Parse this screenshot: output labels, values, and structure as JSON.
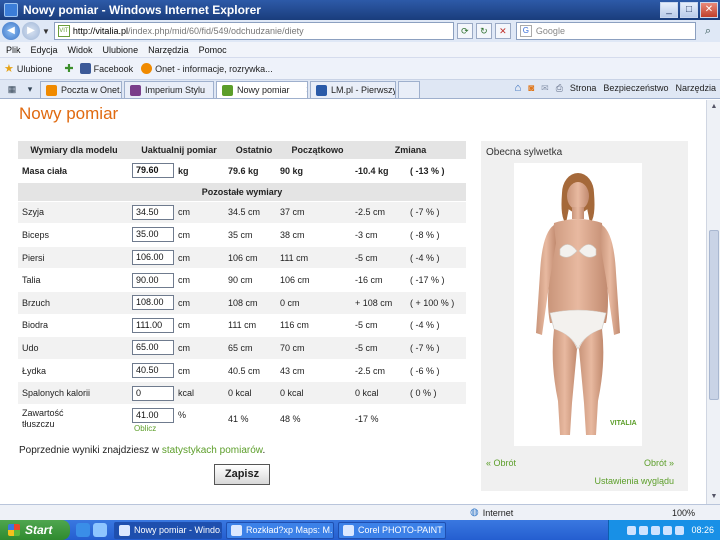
{
  "window": {
    "title": "Nowy pomiar - Windows Internet Explorer"
  },
  "address": {
    "url_host": "http://vitalia.pl",
    "url_path": "/index.php/mid/60/fid/549/odchudzanie/diety",
    "search_placeholder": "Google"
  },
  "menu": [
    "Plik",
    "Edycja",
    "Widok",
    "Ulubione",
    "Narzędzia",
    "Pomoc"
  ],
  "favorites": {
    "label": "Ulubione",
    "items": [
      {
        "label": "Facebook",
        "color": "#3b5998"
      },
      {
        "label": "Onet - informacje, rozrywka...",
        "color": "#f08a00"
      }
    ]
  },
  "tabs": [
    {
      "label": "Poczta w Onet.pl",
      "active": false,
      "color": "#f08a00"
    },
    {
      "label": "Imperium Stylu",
      "active": false,
      "color": "#7a3d8a"
    },
    {
      "label": "Nowy pomiar",
      "active": true,
      "color": "#5c9e2a"
    },
    {
      "label": "LM.pl - Pierwszy p...",
      "active": false,
      "color": "#2a5aa8"
    }
  ],
  "tab_tools": {
    "page": "Strona",
    "security": "Bezpieczeństwo",
    "tools": "Narzędzia"
  },
  "page": {
    "title": "Nowy pomiar",
    "headers": {
      "model": "Wymiary dla modelu",
      "update": "Uaktualnij pomiar",
      "last": "Ostatnio",
      "initial": "Początkowo",
      "change": "Zmiana"
    },
    "main_row": {
      "name": "Masa ciała",
      "value": "79.60",
      "unit": "kg",
      "last": "79.6 kg",
      "initial": "90 kg",
      "change": "-10.4 kg",
      "pct": "( -13 % )"
    },
    "other_header": "Pozostałe wymiary",
    "rows": [
      {
        "name": "Szyja",
        "value": "34.50",
        "unit": "cm",
        "last": "34.5 cm",
        "initial": "37 cm",
        "change": "-2.5 cm",
        "pct": "( -7 % )"
      },
      {
        "name": "Biceps",
        "value": "35.00",
        "unit": "cm",
        "last": "35 cm",
        "initial": "38 cm",
        "change": "-3 cm",
        "pct": "( -8 % )"
      },
      {
        "name": "Piersi",
        "value": "106.00",
        "unit": "cm",
        "last": "106 cm",
        "initial": "111 cm",
        "change": "-5 cm",
        "pct": "( -4 % )"
      },
      {
        "name": "Talia",
        "value": "90.00",
        "unit": "cm",
        "last": "90 cm",
        "initial": "106 cm",
        "change": "-16 cm",
        "pct": "( -17 % )"
      },
      {
        "name": "Brzuch",
        "value": "108.00",
        "unit": "cm",
        "last": "108 cm",
        "initial": "0 cm",
        "change": "+ 108 cm",
        "pct": "( + 100 % )"
      },
      {
        "name": "Biodra",
        "value": "111.00",
        "unit": "cm",
        "last": "111 cm",
        "initial": "116 cm",
        "change": "-5 cm",
        "pct": "( -4 % )"
      },
      {
        "name": "Udo",
        "value": "65.00",
        "unit": "cm",
        "last": "65 cm",
        "initial": "70 cm",
        "change": "-5 cm",
        "pct": "( -7 % )"
      },
      {
        "name": "Łydka",
        "value": "40.50",
        "unit": "cm",
        "last": "40.5 cm",
        "initial": "43 cm",
        "change": "-2.5 cm",
        "pct": "( -6 % )"
      },
      {
        "name": "Spalonych kalorii",
        "value": "0",
        "unit": "kcal",
        "last": "0 kcal",
        "initial": "0 kcal",
        "change": "0 kcal",
        "pct": "( 0 % )"
      }
    ],
    "fat_row": {
      "name_line1": "Zawartość",
      "name_line2": "tłuszczu",
      "value": "41.00",
      "unit": "%",
      "last": "41 %",
      "initial": "48 %",
      "change": "-17 %",
      "calc": "Oblicz"
    },
    "prev_text": "Poprzednie wyniki znajdziesz w ",
    "prev_link": "statystykach pomiarów",
    "prev_end": ".",
    "save": "Zapisz"
  },
  "side": {
    "title": "Obecna sylwetka",
    "brand": "VITALIA",
    "prev": "« Obrót",
    "next": "Obrót »",
    "appearance": "Ustawienia wyglądu"
  },
  "status": {
    "zone": "Internet",
    "zoom": "100%"
  },
  "taskbar": {
    "start": "Start",
    "items": [
      {
        "label": "Nowy pomiar - Windo...",
        "active": true
      },
      {
        "label": "Rozkład?xp Maps: M...",
        "active": false
      },
      {
        "label": "Corel PHOTO-PAINT ...",
        "active": false
      }
    ],
    "clock": "08:26"
  }
}
